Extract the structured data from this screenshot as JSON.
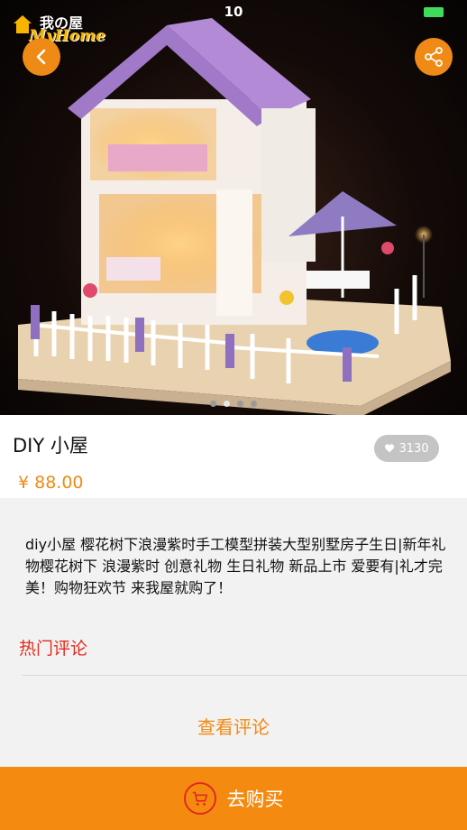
{
  "status": {
    "time": "10"
  },
  "logo": {
    "cn": "我の屋",
    "en": "MyHome"
  },
  "hero": {
    "dots": 4,
    "active_dot": 1
  },
  "product": {
    "title": "DIY 小屋",
    "likes": "3130",
    "price": "¥ 88.00",
    "description": "diy小屋 樱花树下浪漫紫时手工模型拼装大型别墅房子生日|新年礼物樱花树下 浪漫紫时 创意礼物 生日礼物 新品上市 爱要有|礼才完美！购物狂欢节 来我屋就购了！"
  },
  "comments": {
    "hot_label": "热门评论",
    "view_label": "查看评论"
  },
  "buy": {
    "label": "去购买"
  },
  "icons": {
    "back": "chevron-left-icon",
    "share": "share-icon",
    "like": "heart-icon",
    "cart": "cart-icon"
  },
  "colors": {
    "accent": "#f08a16",
    "red": "#e02b1f",
    "purple_roof": "#a07ac8"
  }
}
